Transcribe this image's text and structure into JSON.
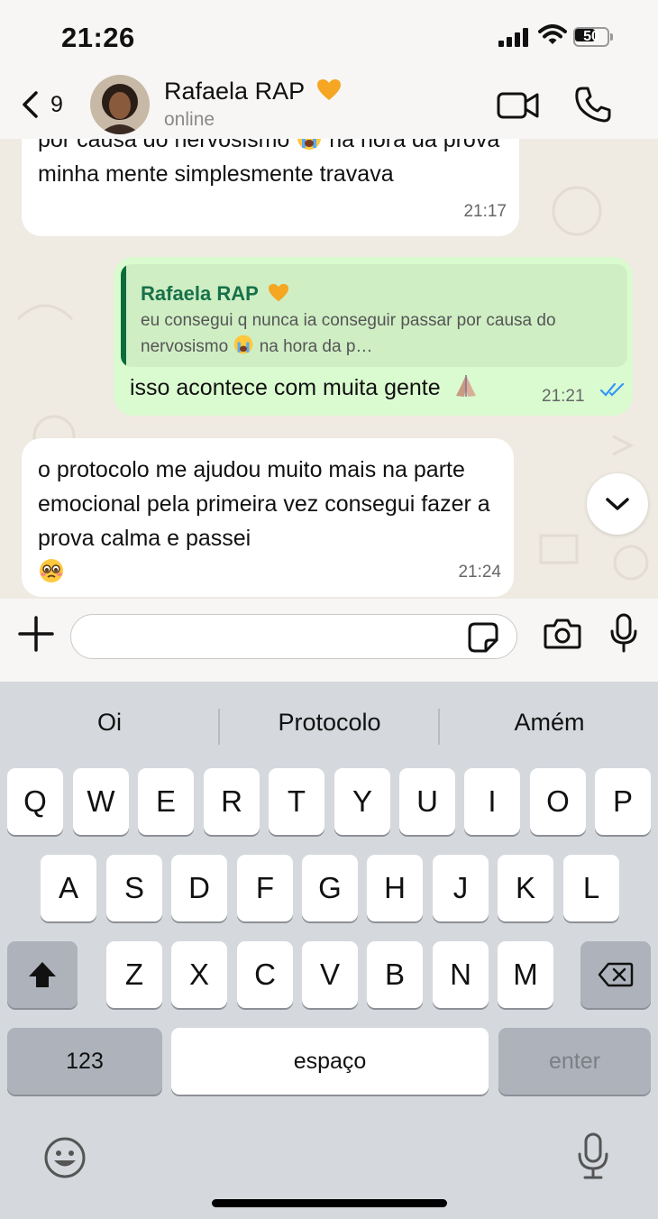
{
  "status_bar": {
    "time": "21:26",
    "battery": "50"
  },
  "header": {
    "back_count": "9",
    "contact_name": "Rafaela RAP",
    "contact_status": "online"
  },
  "messages": [
    {
      "direction": "incoming",
      "text_parts": [
        "por causa do nervosismo ",
        " na hora da prova minha mente simplesmente travava"
      ],
      "time": "21:17"
    },
    {
      "direction": "outgoing",
      "quote_author": "Rafaela RAP",
      "quote_text_parts": [
        "eu consegui q nunca ia conseguir passar por causa do nervosismo ",
        " na hora da p…"
      ],
      "text": "isso acontece com muita gente",
      "time": "21:21",
      "status": "read"
    },
    {
      "direction": "incoming",
      "text": "o protocolo me ajudou muito mais na parte emocional pela primeira vez consegui fazer a prova calma e passei",
      "time": "21:24"
    }
  ],
  "input": {
    "value": "",
    "placeholder": ""
  },
  "keyboard": {
    "suggestions": [
      "Oi",
      "Protocolo",
      "Amém"
    ],
    "row1": [
      "Q",
      "W",
      "E",
      "R",
      "T",
      "Y",
      "U",
      "I",
      "O",
      "P"
    ],
    "row2": [
      "A",
      "S",
      "D",
      "F",
      "G",
      "H",
      "J",
      "K",
      "L"
    ],
    "row3": [
      "Z",
      "X",
      "C",
      "V",
      "B",
      "N",
      "M"
    ],
    "numbers_label": "123",
    "space_label": "espaço",
    "enter_label": "enter"
  },
  "colors": {
    "outgoing_bubble": "#dafbd0",
    "incoming_bubble": "#ffffff",
    "quote_author": "#17714a",
    "read_ticks": "#3497f9",
    "keyboard_bg": "#d5d8dd"
  },
  "icons": {
    "back": "chevron-left-icon",
    "video": "video-camera-icon",
    "call": "phone-icon",
    "plus": "plus-icon",
    "sticker": "sticker-icon",
    "camera": "camera-icon",
    "mic": "microphone-icon",
    "scroll": "chevron-down-icon",
    "shift": "shift-arrow-icon",
    "backspace": "backspace-icon",
    "emoji": "emoji-smiley-icon",
    "dictation": "microphone-icon",
    "msg_emoji_1": "loudly-crying-face-emoji",
    "msg_emoji_2": "loudly-crying-face-emoji",
    "msg_emoji_3": "folded-hands-emoji",
    "msg_emoji_4": "pleading-face-emoji",
    "header_heart": "yellow-heart-emoji"
  }
}
